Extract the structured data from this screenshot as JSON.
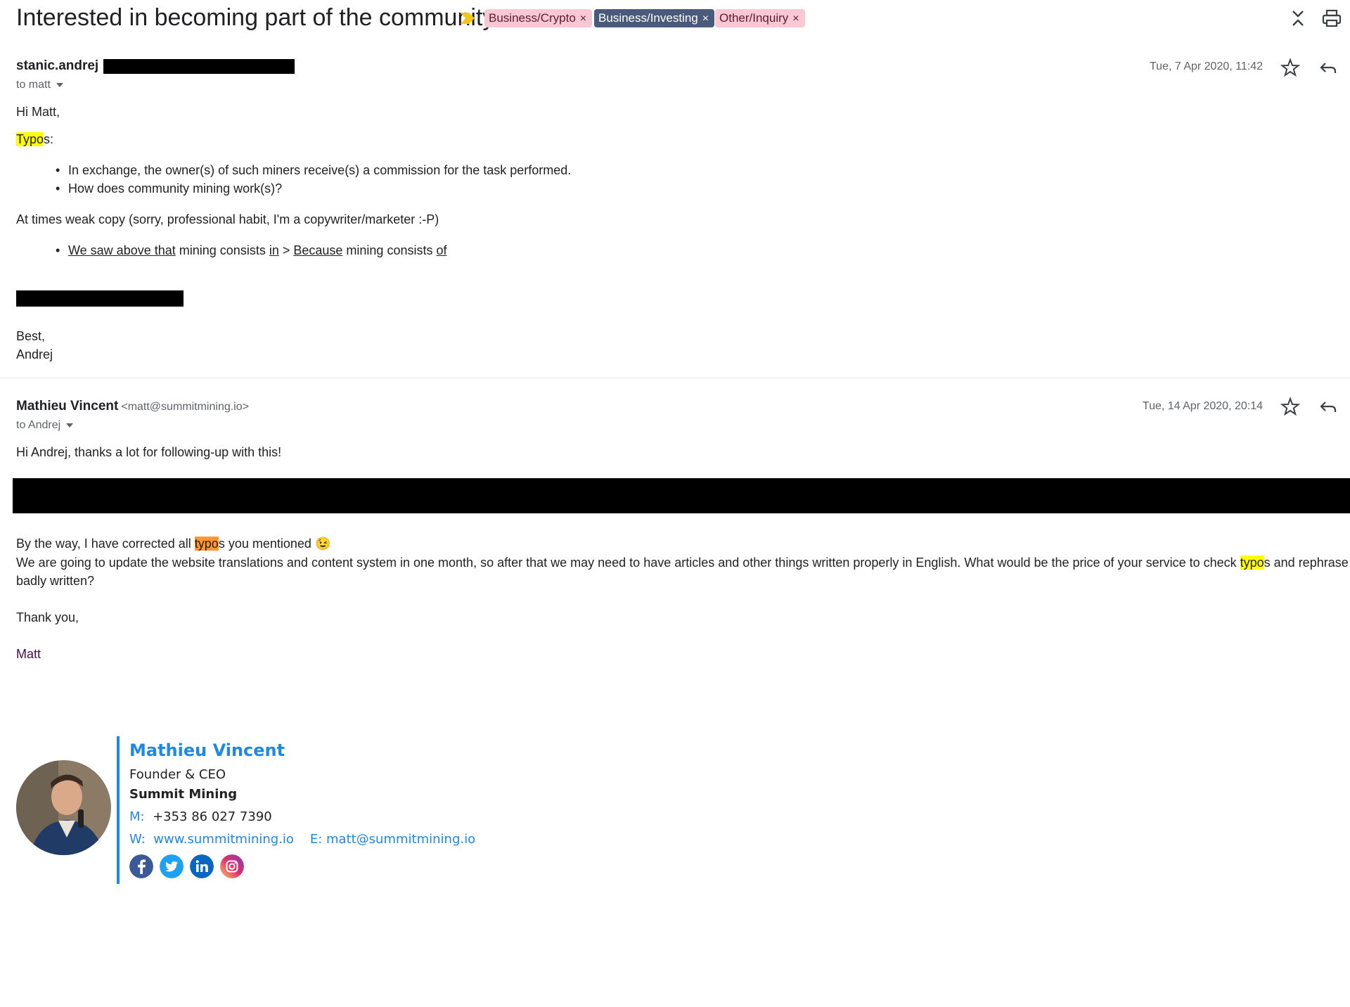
{
  "header": {
    "subject": "Interested in becoming part of the community",
    "labels": [
      {
        "text": "Business/Crypto",
        "remove": "×",
        "bg": "#f8c9d4",
        "fg": "#5f1b2b"
      },
      {
        "text": "Business/Investing",
        "remove": "×",
        "bg": "#4a5a7b",
        "fg": "#ffffff"
      },
      {
        "text": "Other/Inquiry",
        "remove": "×",
        "bg": "#f8c9d4",
        "fg": "#5f1b2b"
      }
    ],
    "icons": {
      "importance": "importance-marker-icon",
      "collapse": "collapse-all-icon",
      "print": "print-icon"
    }
  },
  "message1": {
    "sender": "stanic.andrej",
    "to": "to matt",
    "date": "Tue, 7 Apr 2020, 11:42",
    "greeting": "Hi Matt,",
    "typos_hl": "Typo",
    "typos_rest": "s:",
    "bullets": [
      "In exchange, the owner(s) of such miners receive(s) a commission for the task performed.",
      "How does community mining work(s)?"
    ],
    "weak_copy": "At times weak copy (sorry, professional habit, I'm a copywriter/marketer :-P)",
    "copy_bullet": {
      "p1": "We saw above that",
      "p2": " mining consists ",
      "p3": "in",
      "p4": " > ",
      "p5": "Because",
      "p6": " mining consists ",
      "p7": "of"
    },
    "closing": "Best,",
    "name": "Andrej"
  },
  "message2": {
    "sender": "Mathieu Vincent",
    "sender_email": "<matt@summitmining.io>",
    "to": "to Andrej",
    "date": "Tue, 14 Apr 2020, 20:14",
    "greeting": "Hi Andrej, thanks a lot for following-up with this!",
    "corrected_a": "By the way, I have corrected all ",
    "corrected_hl": "typo",
    "corrected_b": "s you mentioned",
    "emoji": "😉",
    "update_a": "We are going to update the website translations and content system in one month, so after that we may need to have articles and other things written properly in English. What would be the price of your service to check ",
    "update_hl": "typo",
    "update_b": "s and rephrase what is",
    "update_line2": "badly written?",
    "thanks": "Thank you,",
    "name": "Matt"
  },
  "signature": {
    "name": "Mathieu Vincent",
    "title": "Founder & CEO",
    "company": "Summit Mining",
    "mobile_label": "M:",
    "mobile": "+353 86 027 7390",
    "web_label": "W:",
    "web": "www.summitmining.io",
    "email_label": "E:",
    "email": "matt@summitmining.io",
    "social": [
      "facebook-icon",
      "twitter-icon",
      "linkedin-icon",
      "instagram-icon"
    ]
  },
  "colors": {
    "accent": "#1e88e5",
    "highlight_yellow": "#ffff00",
    "highlight_orange": "#ff9632",
    "signoff_purple": "#4a0a4a"
  }
}
